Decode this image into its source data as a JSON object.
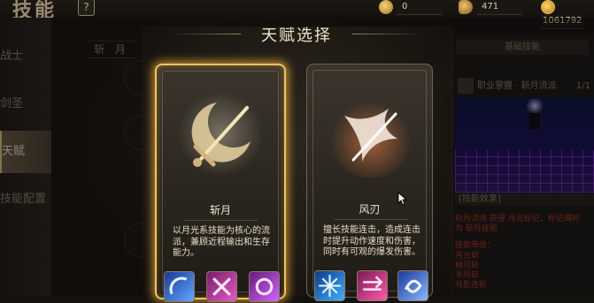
{
  "header": {
    "title": "技能",
    "help": "?",
    "currencies": [
      {
        "name": "currency-1",
        "value": "0"
      },
      {
        "name": "currency-2",
        "value": "471"
      },
      {
        "name": "currency-3",
        "value": "1061792"
      }
    ]
  },
  "sidebar": {
    "items": [
      {
        "label": "战士"
      },
      {
        "label": "剑圣"
      },
      {
        "label": "天赋"
      },
      {
        "label": "技能配置"
      }
    ]
  },
  "tree": {
    "branch_label": "斩 月"
  },
  "right_panel": {
    "tab": "基础技能",
    "row_label": "职业掌握 · 斩月流派",
    "row_level": "1/1",
    "section": "[技能效果]",
    "line1": "斩月流派 获得 月光标记，标记满时",
    "line2": "为 斩月技能",
    "line3": "技能等级：",
    "line4": "月光斩",
    "line5": "崩月斩",
    "line6": "半月斩",
    "line7": "月影连斩"
  },
  "modal": {
    "title": "天赋选择",
    "cards": [
      {
        "name": "斩月",
        "desc": "以月光系技能为核心的流派，兼顾近程输出和生存能力。",
        "selected": true
      },
      {
        "name": "风刃",
        "desc": "擅长技能连击，造成连击时提升动作速度和伤害，同时有可观的爆发伤害。",
        "selected": false
      }
    ]
  },
  "colors": {
    "accent_gold": "#f2c35a",
    "text_light": "#efe4cc",
    "panel_dark": "#1a1815"
  }
}
